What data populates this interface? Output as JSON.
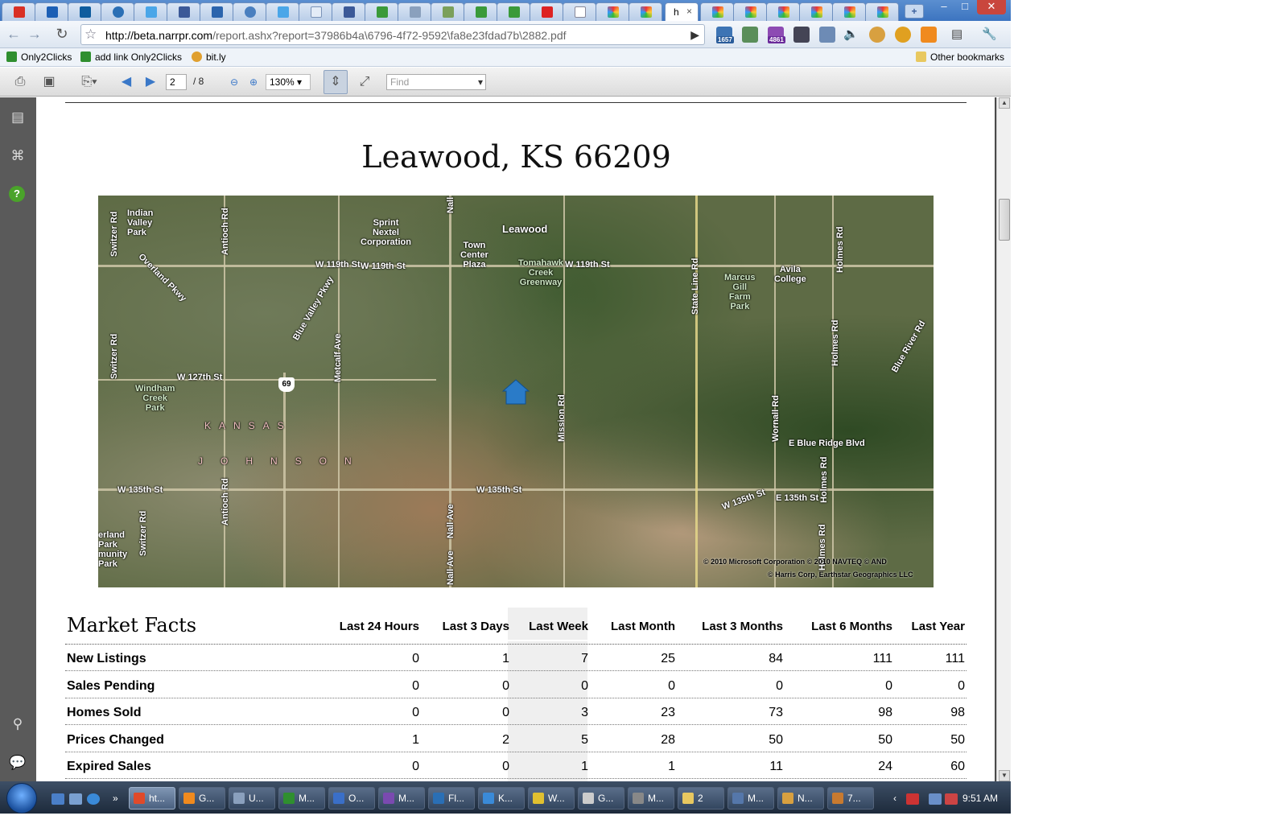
{
  "browser": {
    "active_tab": {
      "label": "h",
      "close": "×"
    },
    "new_tab": "+",
    "window_buttons": [
      "–",
      "□",
      "✕"
    ],
    "url_host": "http://beta.narrpr.com",
    "url_path": "/report.ashx?report=37986b4a\\6796-4f72-9592\\fa8e23fdad7b\\2882.pdf",
    "extension_badges": {
      "ext1": "1657",
      "ext3": "4861"
    },
    "bookmarks": [
      "Only2Clicks",
      "add link Only2Clicks",
      "bit.ly"
    ],
    "other_bookmarks": "Other bookmarks"
  },
  "pdf_toolbar": {
    "page": "2",
    "page_total": "/ 8",
    "zoom": "130%",
    "find_placeholder": "Find"
  },
  "document": {
    "title": "Leawood, KS 66209",
    "map_labels": {
      "indian_valley": "Indian\nValley\nPark",
      "sprint": "Sprint\nNextel\nCorporation",
      "leawood": "Leawood",
      "town_center": "Town\nCenter\nPlaza",
      "tomahawk": "Tomahawk\nCreek\nGreenway",
      "marcus": "Marcus\nGill\nFarm\nPark",
      "avila": "Avila\nCollege",
      "w119_a": "W 119th St",
      "w119_b": "W 119th St",
      "w119_c": "W 119th St",
      "w127": "W 127th St",
      "windham": "Windham\nCreek\nPark",
      "kansas": "KANSAS",
      "johnson": "JOHNSON",
      "w135_a": "W 135th St",
      "w135_b": "W 135th St",
      "w135_c": "W 135th St",
      "e135": "E 135th St",
      "e_blue_ridge": "E Blue Ridge Blvd",
      "overland": "Overland Pkwy",
      "blue_valley": "Blue Valley Pkwy",
      "blue_river": "Blue River Rd",
      "switzer_a": "Switzer Rd",
      "switzer_b": "Switzer Rd",
      "switzer_c": "Switzer Rd",
      "antioch_a": "Antioch Rd",
      "antioch_b": "Antioch Rd",
      "metcalf": "Metcalf Ave",
      "nall_a": "Nall",
      "nall_b": "Nall Ave",
      "nall_c": "Nall Ave",
      "mission": "Mission Rd",
      "state_line": "State Line Rd",
      "wornall": "Wornall Rd",
      "holmes_a": "Holmes Rd",
      "holmes_b": "Holmes Rd",
      "holmes_c": "Holmes Rd",
      "holmes_d": "Holmes Rd",
      "overland_park": "erland\nPark\nmunity\nPark",
      "highway": "69",
      "copyright1": "© 2010 Microsoft Corporation   © 2010 NAVTEQ   © AND",
      "copyright2": "© Harris Corp, Earthstar Geographics LLC"
    },
    "market_facts": {
      "title": "Market Facts",
      "columns": [
        "Last 24 Hours",
        "Last 3 Days",
        "Last Week",
        "Last Month",
        "Last 3 Months",
        "Last 6 Months",
        "Last Year"
      ],
      "rows": [
        {
          "label": "New Listings",
          "values": [
            "0",
            "1",
            "7",
            "25",
            "84",
            "111",
            "111"
          ]
        },
        {
          "label": "Sales Pending",
          "values": [
            "0",
            "0",
            "0",
            "0",
            "0",
            "0",
            "0"
          ]
        },
        {
          "label": "Homes Sold",
          "values": [
            "0",
            "0",
            "3",
            "23",
            "73",
            "98",
            "98"
          ]
        },
        {
          "label": "Prices Changed",
          "values": [
            "1",
            "2",
            "5",
            "28",
            "50",
            "50",
            "50"
          ]
        },
        {
          "label": "Expired Sales",
          "values": [
            "0",
            "0",
            "1",
            "1",
            "11",
            "24",
            "60"
          ]
        }
      ]
    }
  },
  "taskbar": {
    "buttons": [
      "ht...",
      "G...",
      "U...",
      "M...",
      "O...",
      "M...",
      "Fl...",
      "K...",
      "W...",
      "G...",
      "M...",
      "2",
      "M...",
      "N...",
      "7..."
    ],
    "clock": "9:51 AM"
  },
  "colors": {
    "tabstrip": "#3c74c0",
    "map_base": "#5e6b45",
    "pin": "#2a7bc8",
    "highlight_column": "#efefef",
    "sidebar": "#5a5a5a"
  }
}
